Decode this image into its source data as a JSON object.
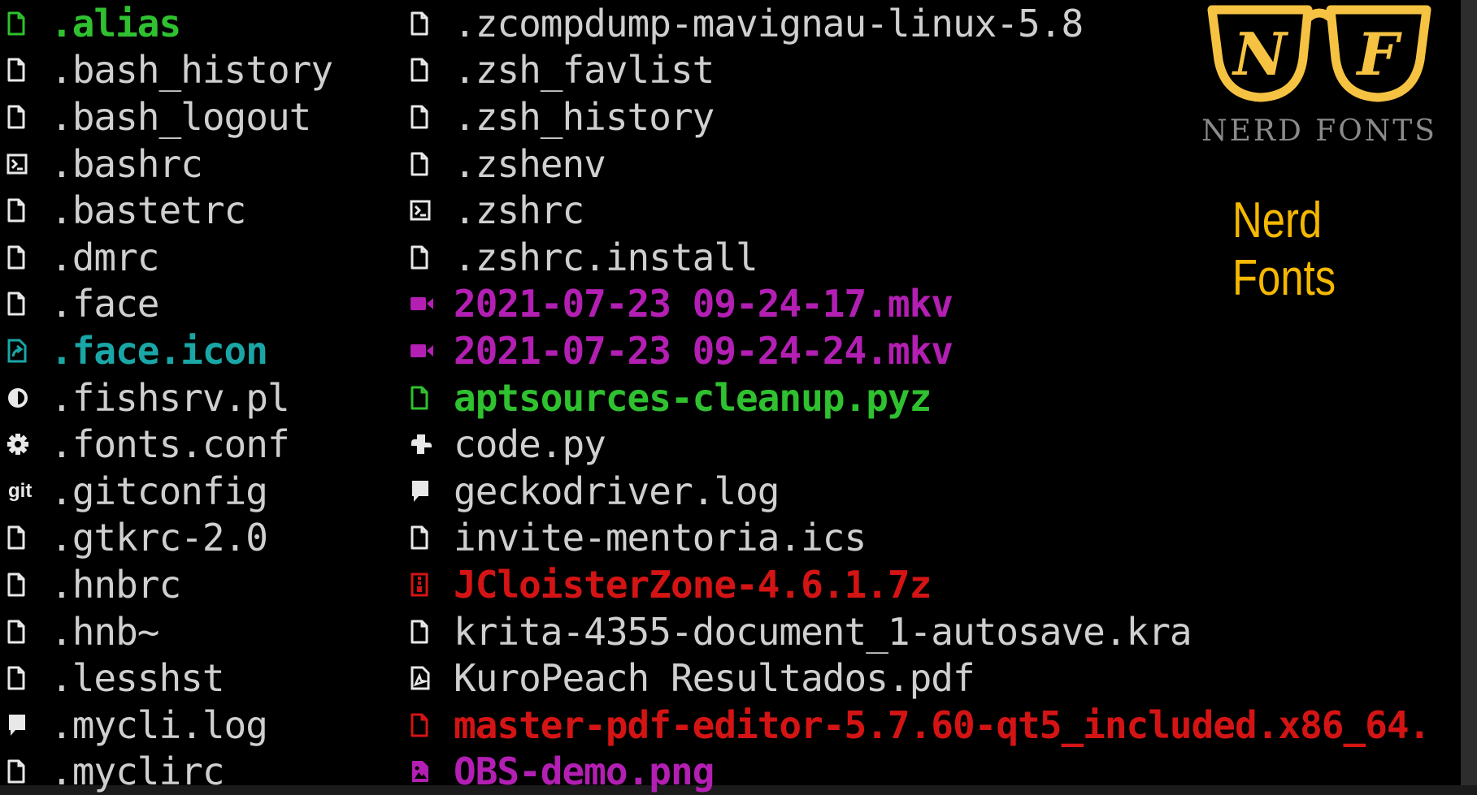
{
  "terminal": {
    "colors": {
      "default": "#cfcfcf",
      "green": "#2fc12f",
      "cyan": "#1aa6a6",
      "magenta": "#b21fb2",
      "red": "#d41414",
      "icon": "#e8e8e8"
    },
    "column1": [
      {
        "name": ".alias",
        "icon": "file-icon",
        "color": "green",
        "bold": true
      },
      {
        "name": ".bash_history",
        "icon": "file-icon",
        "color": "default"
      },
      {
        "name": ".bash_logout",
        "icon": "file-icon",
        "color": "default"
      },
      {
        "name": ".bashrc",
        "icon": "terminal-icon",
        "color": "default"
      },
      {
        "name": ".bastetrc",
        "icon": "file-icon",
        "color": "default"
      },
      {
        "name": ".dmrc",
        "icon": "file-icon",
        "color": "default"
      },
      {
        "name": ".face",
        "icon": "file-icon",
        "color": "default"
      },
      {
        "name": ".face.icon",
        "icon": "symlink-icon",
        "color": "cyan",
        "bold": true
      },
      {
        "name": ".fishsrv.pl",
        "icon": "perl-icon",
        "color": "default"
      },
      {
        "name": ".fonts.conf",
        "icon": "gear-icon",
        "color": "default"
      },
      {
        "name": ".gitconfig",
        "icon": "git-icon",
        "color": "default",
        "icon_text": "git"
      },
      {
        "name": ".gtkrc-2.0",
        "icon": "file-icon",
        "color": "default"
      },
      {
        "name": ".hnbrc",
        "icon": "file-icon",
        "color": "default"
      },
      {
        "name": ".hnb~",
        "icon": "file-icon",
        "color": "default"
      },
      {
        "name": ".lesshst",
        "icon": "file-icon",
        "color": "default"
      },
      {
        "name": ".mycli.log",
        "icon": "log-icon",
        "color": "default"
      },
      {
        "name": ".myclirc",
        "icon": "file-icon",
        "color": "default"
      }
    ],
    "column2": [
      {
        "name": ".zcompdump-mavignau-linux-5.8",
        "icon": "file-icon",
        "color": "default"
      },
      {
        "name": ".zsh_favlist",
        "icon": "file-icon",
        "color": "default"
      },
      {
        "name": ".zsh_history",
        "icon": "file-icon",
        "color": "default"
      },
      {
        "name": ".zshenv",
        "icon": "file-icon",
        "color": "default"
      },
      {
        "name": ".zshrc",
        "icon": "terminal-icon",
        "color": "default"
      },
      {
        "name": ".zshrc.install",
        "icon": "file-icon",
        "color": "default"
      },
      {
        "name": "2021-07-23 09-24-17.mkv",
        "icon": "video-icon",
        "color": "magenta",
        "bold": true
      },
      {
        "name": "2021-07-23 09-24-24.mkv",
        "icon": "video-icon",
        "color": "magenta",
        "bold": true
      },
      {
        "name": "aptsources-cleanup.pyz",
        "icon": "file-icon",
        "color": "green",
        "bold": true
      },
      {
        "name": "code.py",
        "icon": "python-icon",
        "color": "default"
      },
      {
        "name": "geckodriver.log",
        "icon": "log-icon",
        "color": "default"
      },
      {
        "name": "invite-mentoria.ics",
        "icon": "file-icon",
        "color": "default"
      },
      {
        "name": "JCloisterZone-4.6.1.7z",
        "icon": "archive-icon",
        "color": "red",
        "bold": true
      },
      {
        "name": "krita-4355-document_1-autosave.kra",
        "icon": "file-icon",
        "color": "default"
      },
      {
        "name": "KuroPeach Resultados.pdf",
        "icon": "pdf-icon",
        "color": "default"
      },
      {
        "name": "master-pdf-editor-5.7.60-qt5_included.x86_64.",
        "icon": "file-icon",
        "color": "red",
        "bold": true
      },
      {
        "name": "OBS-demo.png",
        "icon": "image-icon",
        "color": "magenta",
        "bold": true
      }
    ]
  },
  "logo": {
    "letters": "NF",
    "caption": "NERD FONTS",
    "frame_color": "#f5c242"
  },
  "brand": {
    "title": "Nerd Fonts",
    "color": "#f5b800"
  }
}
